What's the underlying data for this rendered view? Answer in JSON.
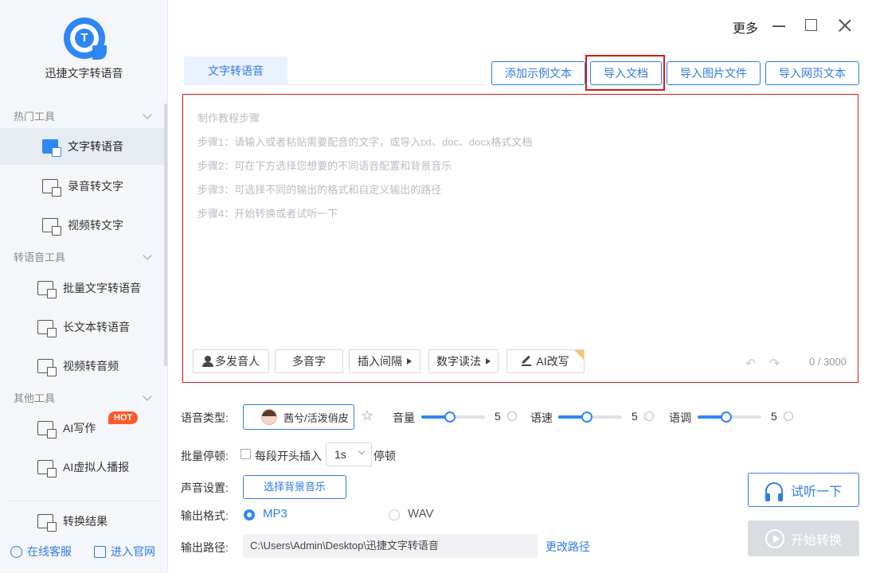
{
  "app": {
    "name": "迅捷文字转语音",
    "logo_letter": "T",
    "more_label": "更多"
  },
  "sidebar": {
    "sections": [
      {
        "title": "热门工具",
        "items": [
          "文字转语音",
          "录音转文字",
          "视频转文字"
        ]
      },
      {
        "title": "转语音工具",
        "items": [
          "批量文字转语音",
          "长文本转语音",
          "视频转音频"
        ]
      },
      {
        "title": "其他工具",
        "items": [
          "AI写作",
          "AI虚拟人播报"
        ]
      }
    ],
    "hot_badge": "HOT",
    "result": "转换结果",
    "footer": {
      "support": "在线客服",
      "website": "进入官网"
    }
  },
  "tab": {
    "label": "文字转语音"
  },
  "top_buttons": [
    "添加示例文本",
    "导入文档",
    "导入图片文件",
    "导入网页文本"
  ],
  "editor": {
    "guide": [
      "制作教程步骤",
      "步骤1：请输入或者粘贴需要配音的文字，或导入txt、doc、docx格式文档",
      "步骤2：可在下方选择您想要的不同语音配置和背景音乐",
      "步骤3：可选择不同的输出的格式和自定义输出的路径",
      "步骤4：开始转换或者试听一下"
    ],
    "tools": [
      "多发音人",
      "多音字",
      "插入间隔",
      "数字读法",
      "AI改写"
    ],
    "counter": "0 / 3000"
  },
  "settings": {
    "voice_type_label": "语音类型:",
    "voice_name": "茜兮/活泼俏皮",
    "volume": {
      "label": "音量",
      "value": "5"
    },
    "speed": {
      "label": "语速",
      "value": "5"
    },
    "pitch": {
      "label": "语调",
      "value": "5"
    },
    "pause": {
      "label": "批量停顿:",
      "checkbox": "每段开头插入",
      "duration": "1s",
      "suffix": "停顿"
    },
    "sound_label": "声音设置:",
    "bgm_button": "选择背景音乐",
    "format_label": "输出格式:",
    "formats": [
      "MP3",
      "WAV"
    ],
    "selected_format": "MP3",
    "path_label": "输出路径:",
    "path": "C:\\Users\\Admin\\Desktop\\迅捷文字转语音",
    "change_path": "更改路径"
  },
  "actions": {
    "preview": "试听一下",
    "start": "开始转换"
  },
  "colors": {
    "accent": "#2f7be6",
    "highlight_box": "#d71818",
    "hot": "#ff5a2a"
  }
}
